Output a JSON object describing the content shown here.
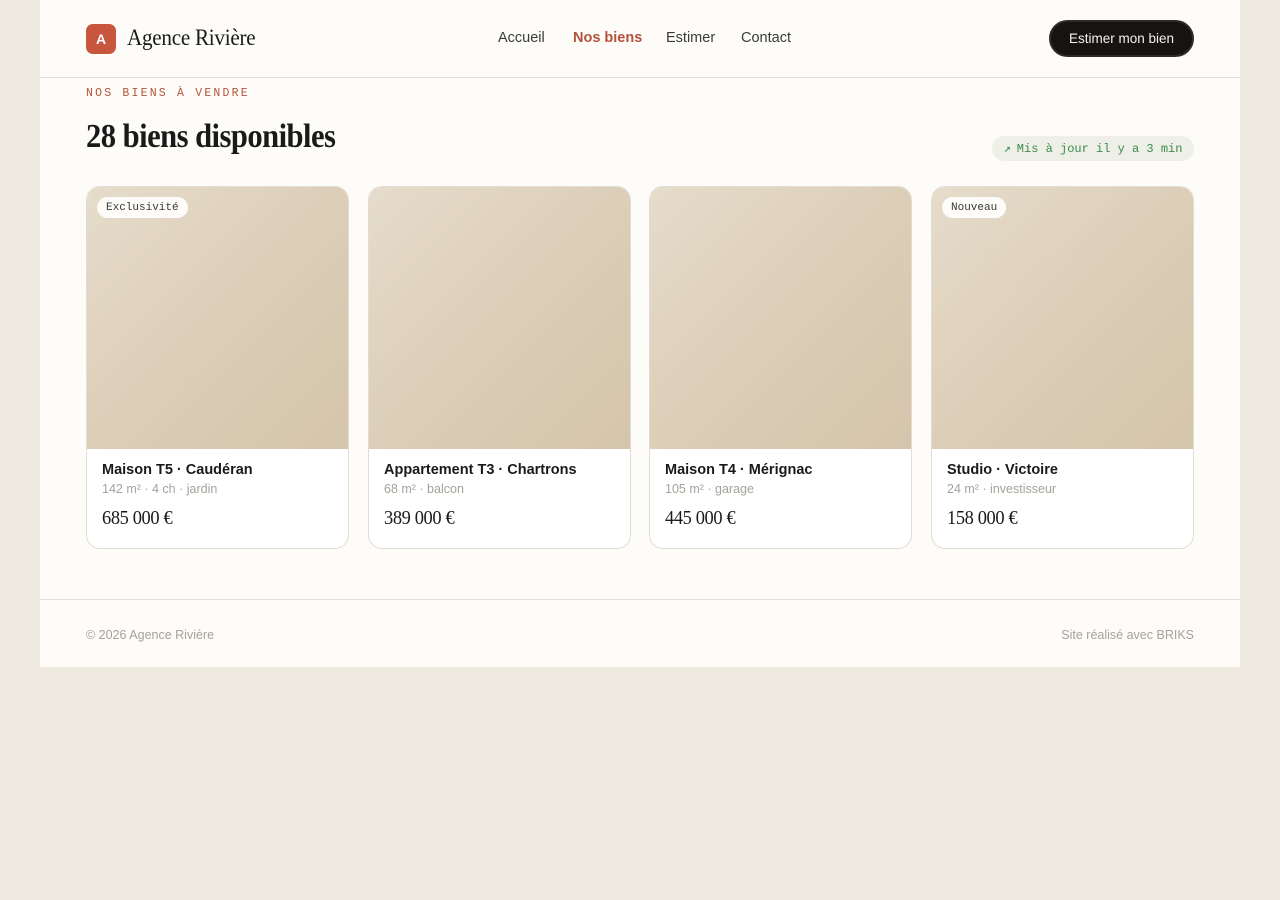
{
  "brand": {
    "logo_letter": "A",
    "name": "Agence Rivière",
    "accent_color": "#c8553d"
  },
  "nav": {
    "items": [
      {
        "label": "Accueil",
        "active": false
      },
      {
        "label": "Nos biens",
        "active": true
      },
      {
        "label": "Estimer",
        "active": false
      },
      {
        "label": "Contact",
        "active": false
      }
    ],
    "cta_label": "Estimer mon bien"
  },
  "section": {
    "eyebrow": "NOS BIENS À VENDRE",
    "heading": "28 biens disponibles",
    "updated_arrow": "↗",
    "updated_text": "Mis à jour il y a 3 min"
  },
  "listings": [
    {
      "badge": "Exclusivité",
      "title": "Maison T5 · Caudéran",
      "meta": "142 m² · 4 ch · jardin",
      "price": "685 000 €"
    },
    {
      "badge": "",
      "title": "Appartement T3 · Chartrons",
      "meta": "68 m² · balcon",
      "price": "389 000 €"
    },
    {
      "badge": "",
      "title": "Maison T4 · Mérignac",
      "meta": "105 m² · garage",
      "price": "445 000 €"
    },
    {
      "badge": "Nouveau",
      "title": "Studio · Victoire",
      "meta": "24 m² · investisseur",
      "price": "158 000 €"
    }
  ],
  "footer": {
    "copyright": "© 2026 Agence Rivière",
    "credit": "Site réalisé avec BRIKS"
  }
}
